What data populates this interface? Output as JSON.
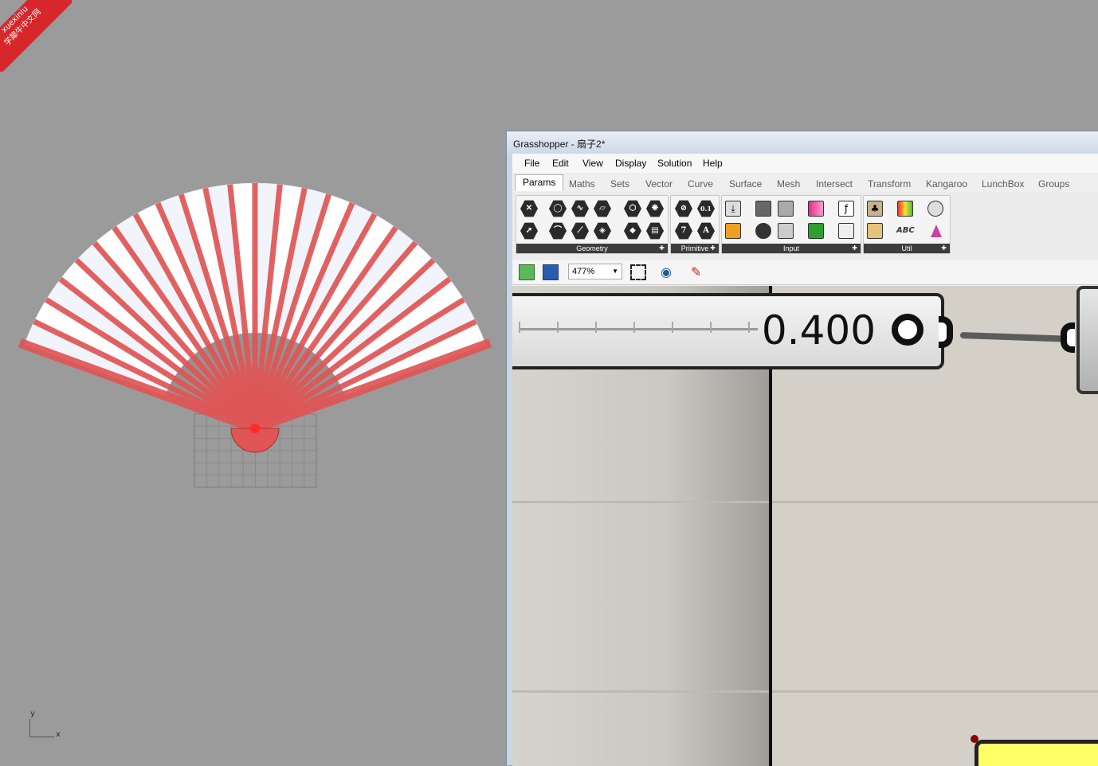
{
  "watermark": {
    "line1": "xuexiniu",
    "line2": "学犀牛中文网"
  },
  "viewport": {
    "axis_x": "x",
    "axis_y": "y"
  },
  "window": {
    "title": "Grasshopper - 扇子2*"
  },
  "menu": [
    "File",
    "Edit",
    "View",
    "Display",
    "Solution",
    "Help"
  ],
  "tabs": [
    "Params",
    "Maths",
    "Sets",
    "Vector",
    "Curve",
    "Surface",
    "Mesh",
    "Intersect",
    "Transform",
    "Kangaroo",
    "LunchBox",
    "Groups"
  ],
  "active_tab": "Params",
  "ribbon_groups": {
    "geometry": "Geometry",
    "primitive": "Primitive",
    "input": "Input",
    "util": "Util"
  },
  "primitive_glyphs": {
    "number": "0.1",
    "integer": "7",
    "text": "A"
  },
  "util_glyph": "ABC",
  "toolbar": {
    "zoom": "477%"
  },
  "canvas": {
    "slider_value": "0.400"
  },
  "colors": {
    "fan_red": "#e05555",
    "fan_paper": "#ffffff",
    "panel_yellow": "#ffff66"
  }
}
